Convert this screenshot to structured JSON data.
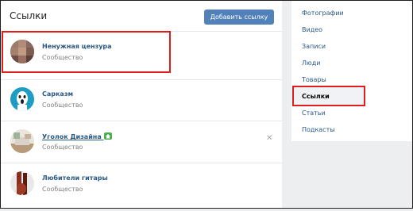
{
  "header": {
    "title": "Ссылки",
    "add_button": "Добавить ссылку"
  },
  "links": [
    {
      "name": "Ненужная цензура",
      "type": "Сообщество"
    },
    {
      "name": "Сарказм",
      "type": "Сообщество"
    },
    {
      "name": "Уголок Дизайна",
      "type": "Сообщество",
      "badge_icon": "house-icon"
    },
    {
      "name": "Любители гитары",
      "type": "Сообщество"
    }
  ],
  "close_symbol": "✕",
  "sidebar": {
    "items": [
      {
        "label": "Фотографии"
      },
      {
        "label": "Видео"
      },
      {
        "label": "Записи"
      },
      {
        "label": "Люди"
      },
      {
        "label": "Товары"
      },
      {
        "label": "Ссылки",
        "active": true
      },
      {
        "label": "Статьи"
      },
      {
        "label": "Подкасты"
      }
    ]
  },
  "colors": {
    "accent": "#5181b8",
    "link": "#2a5885",
    "highlight_box": "#e01c1c"
  }
}
